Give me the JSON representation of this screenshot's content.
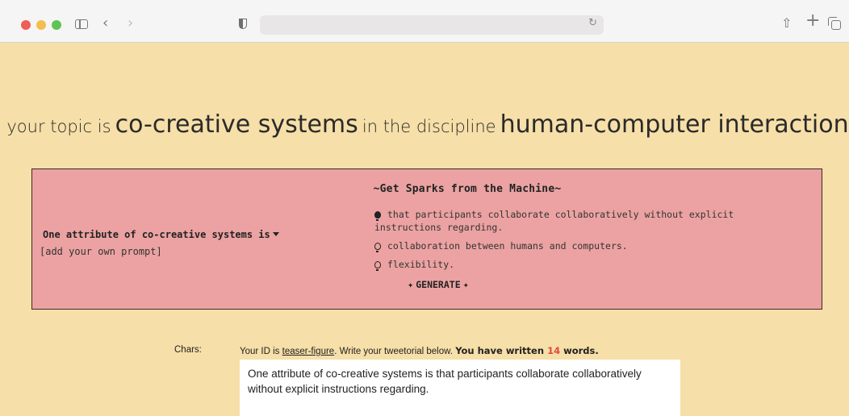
{
  "browser": {
    "address": ""
  },
  "heading": {
    "prefix": "your topic is",
    "topic": "co-creative systems",
    "middle": "in the discipline",
    "discipline": "human-computer interaction"
  },
  "panel": {
    "title": "~Get Sparks from the Machine~",
    "prompt_label": "One attribute of co-creative systems is",
    "own_prompt_placeholder": "[add your own prompt]",
    "suggestions": [
      {
        "text": "that participants collaborate collaboratively without explicit instructions regarding.",
        "selected": true
      },
      {
        "text": "collaboration between humans and computers.",
        "selected": false
      },
      {
        "text": "flexibility.",
        "selected": false
      }
    ],
    "generate_label": "GENERATE"
  },
  "editor": {
    "chars_label": "Chars:",
    "id_prefix": "Your ID is",
    "id_value": "teaser-figure",
    "id_suffix": ". Write your tweetorial below.",
    "written_prefix": "You have written",
    "word_count": "14",
    "written_suffix": "words.",
    "text": "One attribute of co-creative systems is that participants collaborate collaboratively without explicit instructions regarding."
  },
  "colors": {
    "page_bg": "#f6dfa8",
    "panel_bg": "#eca2a2",
    "count": "#e2483e"
  }
}
